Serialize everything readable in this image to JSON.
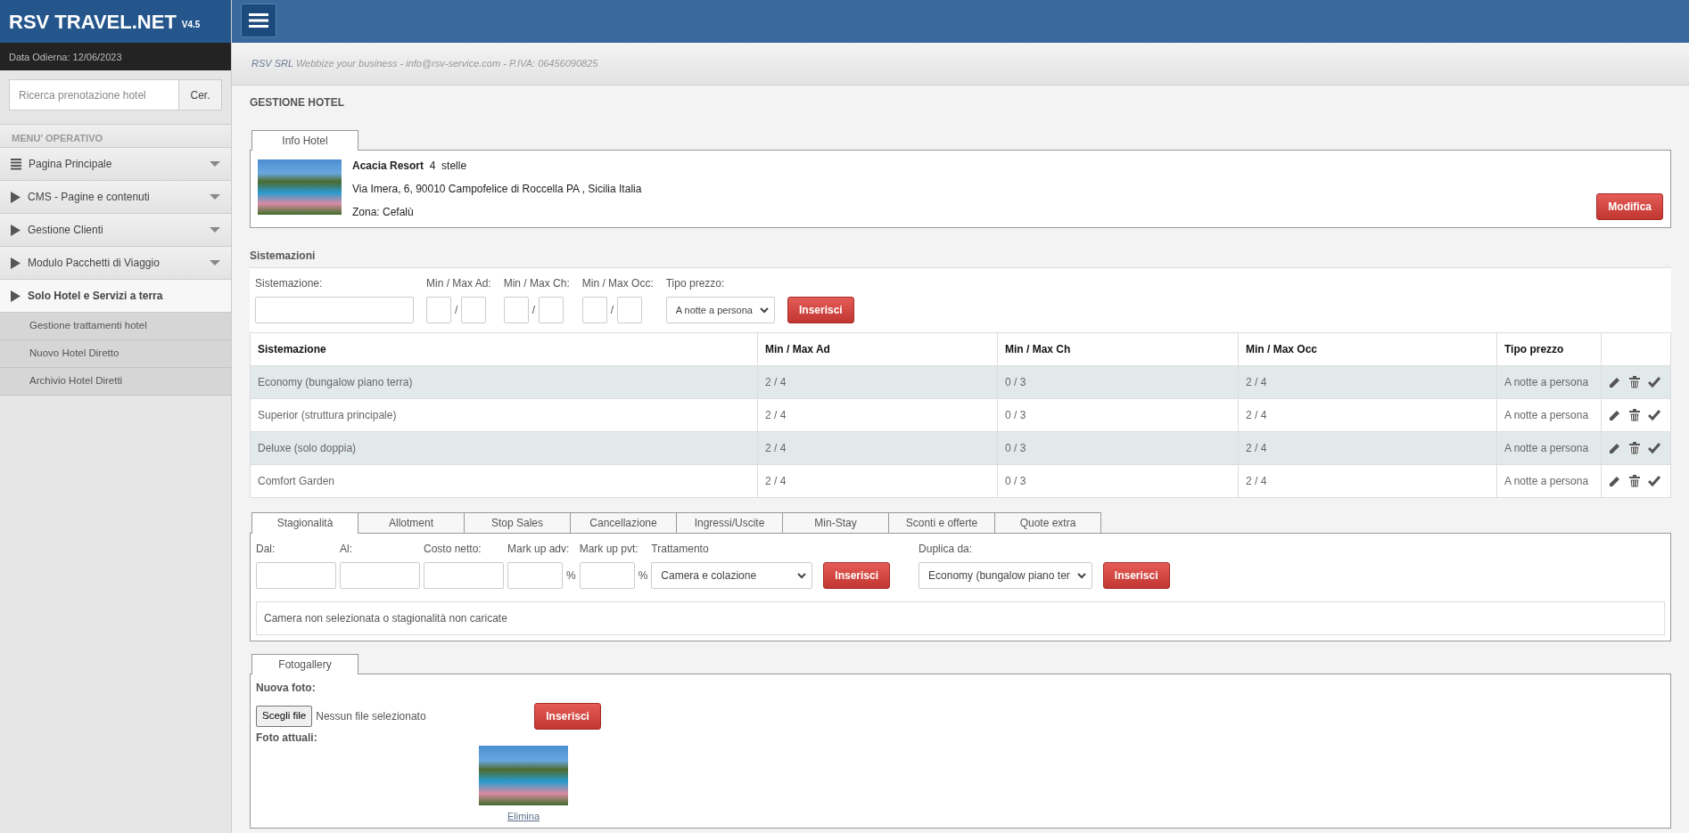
{
  "header": {
    "brand": "RSV TRAVEL.NET",
    "version": "V4.5"
  },
  "sidebar": {
    "date": "Data Odierna: 12/06/2023",
    "search": {
      "placeholder": "Ricerca prenotazione hotel",
      "button": "Cer."
    },
    "menu_title": "MENU' OPERATIVO",
    "items": [
      {
        "label": "Pagina Principale",
        "kind": "list",
        "expanded": false
      },
      {
        "label": "CMS - Pagine e contenuti",
        "kind": "section",
        "expanded": false
      },
      {
        "label": "Gestione Clienti",
        "kind": "section",
        "expanded": false
      },
      {
        "label": "Modulo Pacchetti di Viaggio",
        "kind": "section",
        "expanded": false
      },
      {
        "label": "Solo Hotel e Servizi a terra",
        "kind": "section",
        "expanded": true,
        "children": [
          {
            "label": "Gestione trattamenti hotel"
          },
          {
            "label": "Nuovo Hotel Diretto"
          },
          {
            "label": "Archivio Hotel Diretti"
          }
        ]
      }
    ]
  },
  "company_line": {
    "company": "RSV SRL",
    "text": "Webbize your business - info@rsv-service.com - P.IVA: 06456090825"
  },
  "page_title": "GESTIONE HOTEL",
  "info_hotel": {
    "tab": "Info Hotel",
    "name": "Acacia Resort",
    "rating": "4  stelle",
    "address": "Via Imera, 6, 90010 Campofelice di Roccella PA , Sicilia  Italia",
    "zone": "Zona: Cefalù",
    "button": "Modifica"
  },
  "sistemazioni": {
    "title": "Sistemazioni",
    "form": {
      "name_label": "Sistemazione:",
      "ranges": [
        {
          "label": "Min / Max Ad:",
          "separator": "/"
        },
        {
          "label": "Min / Max Ch:",
          "separator": "/"
        },
        {
          "label": "Min / Max Occ:",
          "separator": "/"
        }
      ],
      "price_label": "Tipo prezzo:",
      "price_value": "A notte a persona",
      "button": "Inserisci"
    },
    "table": {
      "columns": [
        "Sistemazione",
        "Min / Max Ad",
        "Min / Max Ch",
        "Min / Max Occ",
        "Tipo prezzo"
      ],
      "rows": [
        [
          "Economy (bungalow piano terra)",
          "2  / 4",
          "0  / 3",
          "2  / 4",
          "A notte a persona"
        ],
        [
          "Superior (struttura principale)",
          "2  / 4",
          "0  / 3",
          "2  / 4",
          "A notte a persona"
        ],
        [
          "Deluxe (solo doppia)",
          "2  / 4",
          "0  / 3",
          "2  / 4",
          "A notte a persona"
        ],
        [
          "Comfort Garden",
          "2  / 4",
          "0  / 3",
          "2  / 4",
          "A notte a persona"
        ]
      ]
    }
  },
  "tariffe": {
    "tabs": [
      {
        "label": "Stagionalità",
        "selected": true
      },
      {
        "label": "Allotment",
        "selected": false
      },
      {
        "label": "Stop Sales",
        "selected": false
      },
      {
        "label": "Cancellazione",
        "selected": false
      },
      {
        "label": "Ingressi/Uscite",
        "selected": false
      },
      {
        "label": "Min-Stay",
        "selected": false
      },
      {
        "label": "Sconti e offerte",
        "selected": false
      },
      {
        "label": "Quote extra",
        "selected": false
      }
    ],
    "fields": [
      {
        "label": "Dal:"
      },
      {
        "label": "Al:"
      },
      {
        "label": "Costo netto:"
      },
      {
        "label": "Mark up adv:",
        "suffix": "%"
      },
      {
        "label": "Mark up pvt:",
        "suffix": "%"
      }
    ],
    "treatment": {
      "label": "Trattamento",
      "value": "Camera e colazione"
    },
    "button": "Inserisci",
    "duplicate": {
      "label": "Duplica da:",
      "value": "Economy (bungalow piano ter",
      "button": "Inserisci"
    },
    "message": "Camera non selezionata o stagionalità non caricate"
  },
  "fotogallery": {
    "tab": "Fotogallery",
    "new_label": "Nuova foto:",
    "file_button": "Scegli file",
    "file_status": "Nessun file selezionato",
    "button": "Inserisci",
    "current_label": "Foto attuali:",
    "photos": [
      {
        "action": "Elimina"
      }
    ]
  }
}
